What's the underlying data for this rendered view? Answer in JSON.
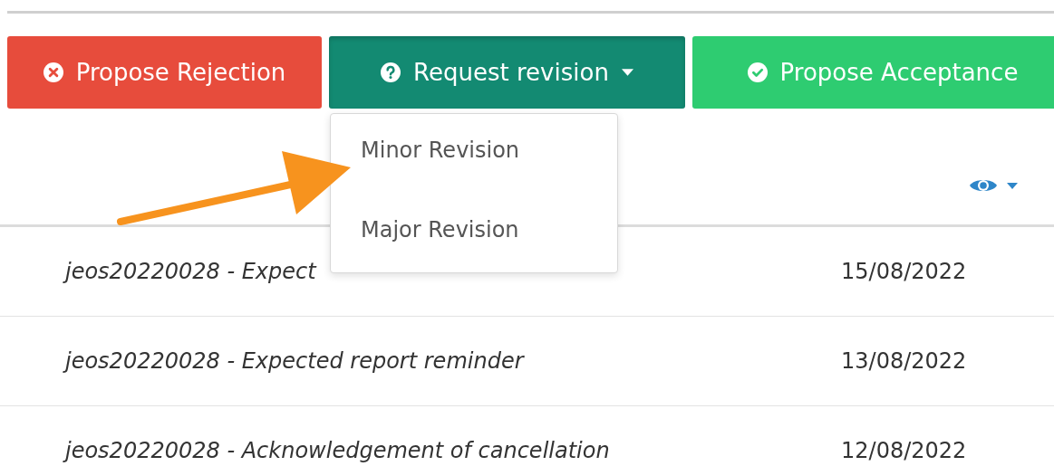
{
  "buttons": [
    {
      "label": "Propose Rejection",
      "kind": "reject",
      "expanded": false
    },
    {
      "label": "Request revision",
      "kind": "revision",
      "expanded": true
    },
    {
      "label": "Propose Acceptance",
      "kind": "accept",
      "expanded": false
    }
  ],
  "dropdown_items": [
    "Minor Revision",
    "Major Revision"
  ],
  "rows": [
    {
      "subject": "jeos20220028 - Expect",
      "date": "15/08/2022"
    },
    {
      "subject": "jeos20220028 - Expected report reminder",
      "date": "13/08/2022"
    },
    {
      "subject": "jeos20220028 - Acknowledgement of cancellation",
      "date": "12/08/2022"
    }
  ]
}
